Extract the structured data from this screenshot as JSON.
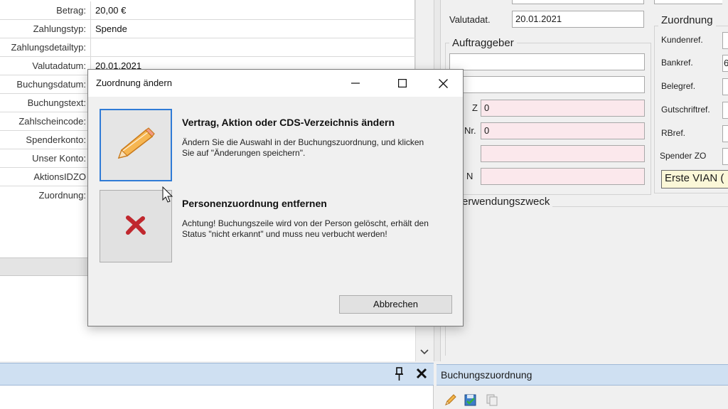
{
  "left_grid": {
    "rows": [
      {
        "label": "Betrag:",
        "value": "20,00 €"
      },
      {
        "label": "Zahlungstyp:",
        "value": "Spende"
      },
      {
        "label": "Zahlungsdetailtyp:",
        "value": ""
      },
      {
        "label": "Valutadatum:",
        "value": "20.01.2021"
      },
      {
        "label": "Buchungsdatum:",
        "value": ""
      },
      {
        "label": "Buchungstext:",
        "value": ""
      },
      {
        "label": "Zahlscheincode:",
        "value": ""
      },
      {
        "label": "Spenderkonto:",
        "value": ""
      },
      {
        "label": "Unser Konto:",
        "value": ""
      },
      {
        "label": "AktionsIDZO",
        "value": ""
      },
      {
        "label": "Zuordnung:",
        "value": ""
      }
    ]
  },
  "right_form": {
    "valutadat_label": "Valutadat.",
    "valutadat_value": "20.01.2021",
    "auftraggeber_title": "Auftraggeber",
    "partial_label_1": "Z",
    "partial_label_2": "Nr.",
    "partial_label_4": "N",
    "pink_field_1": "0",
    "pink_field_2": "0",
    "verwendungszweck_title": "erwendungszweck",
    "zuordnung_title": "Zuordnung",
    "zuordnung_fields": [
      {
        "label": "Kundenref.",
        "value": ""
      },
      {
        "label": "Bankref.",
        "value": "6"
      },
      {
        "label": "Belegref.",
        "value": ""
      },
      {
        "label": "Gutschriftref.",
        "value": ""
      },
      {
        "label": "RBref.",
        "value": ""
      },
      {
        "label": "Spender ZO",
        "value": ""
      }
    ],
    "erste_vian": "Erste VIAN ("
  },
  "bottom": {
    "right_panel_title": "Buchungszuordnung"
  },
  "dialog": {
    "title": "Zuordnung ändern",
    "option1": {
      "title": "Vertrag, Aktion oder CDS-Verzeichnis ändern",
      "description": "Ändern Sie die Auswahl in der Buchungszuordnung, und klicken Sie auf \"Änderungen speichern\"."
    },
    "option2": {
      "title": "Personenzuordnung entfernen",
      "description": "Achtung! Buchungszeile wird von der Person gelöscht, erhält den Status \"nicht erkannt\" und muss neu verbucht werden!"
    },
    "cancel_label": "Abbrechen"
  },
  "colors": {
    "accent": "#2f7bd6",
    "pink_field": "#fbe8ec",
    "panel_bar": "#cfe0f2",
    "delete_red": "#c0282e",
    "pencil_orange": "#f0a030"
  }
}
